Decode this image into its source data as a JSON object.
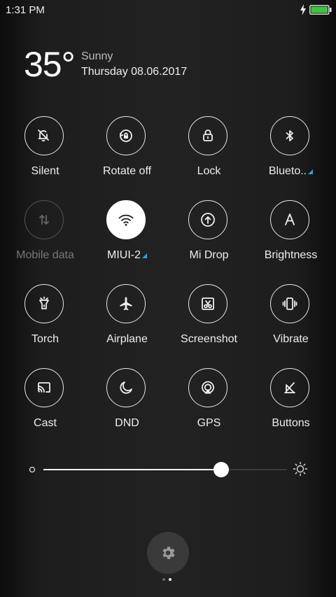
{
  "status": {
    "time": "1:31 PM",
    "battery_color": "#3fc43f"
  },
  "weather": {
    "temperature": "35°",
    "condition": "Sunny",
    "date": "Thursday 08.06.2017"
  },
  "tiles": [
    {
      "label": "Silent",
      "icon": "bell-off-icon",
      "state": "off"
    },
    {
      "label": "Rotate off",
      "icon": "rotate-lock-icon",
      "state": "off"
    },
    {
      "label": "Lock",
      "icon": "lock-icon",
      "state": "off"
    },
    {
      "label": "Blueto..",
      "icon": "bluetooth-icon",
      "state": "off",
      "has_submenu": true
    },
    {
      "label": "Mobile data",
      "icon": "mobile-data-icon",
      "state": "disabled"
    },
    {
      "label": "MIUI-2",
      "icon": "wifi-icon",
      "state": "on",
      "has_submenu": true
    },
    {
      "label": "Mi Drop",
      "icon": "mi-drop-icon",
      "state": "off"
    },
    {
      "label": "Brightness",
      "icon": "auto-brightness-icon",
      "state": "off"
    },
    {
      "label": "Torch",
      "icon": "torch-icon",
      "state": "off"
    },
    {
      "label": "Airplane",
      "icon": "airplane-icon",
      "state": "off"
    },
    {
      "label": "Screenshot",
      "icon": "screenshot-icon",
      "state": "off"
    },
    {
      "label": "Vibrate",
      "icon": "vibrate-icon",
      "state": "off"
    },
    {
      "label": "Cast",
      "icon": "cast-icon",
      "state": "off"
    },
    {
      "label": "DND",
      "icon": "moon-icon",
      "state": "off"
    },
    {
      "label": "GPS",
      "icon": "gps-icon",
      "state": "off"
    },
    {
      "label": "Buttons",
      "icon": "buttons-icon",
      "state": "off"
    }
  ],
  "brightness": {
    "level_fraction": 0.73
  },
  "colors": {
    "accent": "#29a3e6",
    "active_tile": "#ffffff"
  },
  "pager": {
    "page_count": 2,
    "current_page": 2
  }
}
